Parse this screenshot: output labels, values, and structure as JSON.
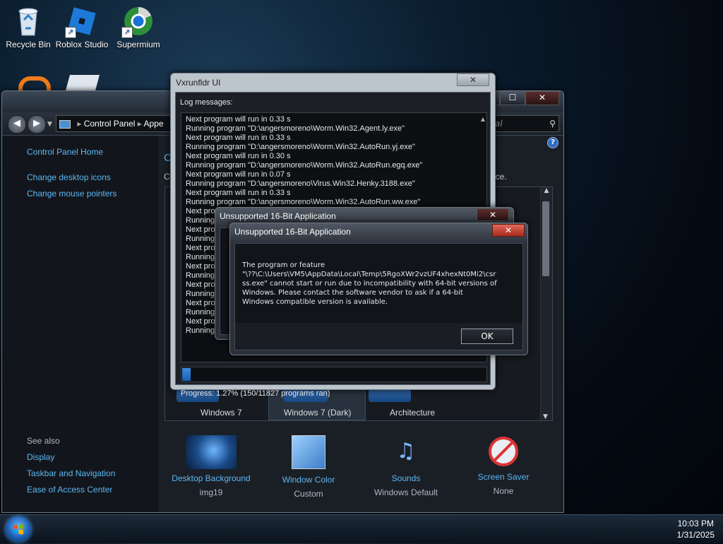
{
  "desktop": {
    "icons": [
      {
        "label": "Recycle Bin",
        "icon": "recycle-bin-icon"
      },
      {
        "label": "Roblox Studio",
        "icon": "roblox-studio-icon"
      },
      {
        "label": "Supermium",
        "icon": "supermium-icon"
      }
    ]
  },
  "control_panel": {
    "breadcrumb": [
      "Control Panel",
      "Appe"
    ],
    "search_placeholder": "al",
    "left_links": [
      "Control Panel Home",
      "Change desktop icons",
      "Change mouse pointers"
    ],
    "heading_partial": "C",
    "text_partial_left": "C",
    "text_partial_right": "nce.",
    "themes": [
      "Windows 7",
      "Windows 7 (Dark)",
      "Architecture"
    ],
    "see_also_label": "See also",
    "see_also_links": [
      "Display",
      "Taskbar and Navigation",
      "Ease of Access Center"
    ],
    "bottom_items": [
      {
        "label": "Desktop Background",
        "value": "img19"
      },
      {
        "label": "Window Color",
        "value": "Custom"
      },
      {
        "label": "Sounds",
        "value": "Windows Default"
      },
      {
        "label": "Screen Saver",
        "value": "None"
      }
    ]
  },
  "vx": {
    "title": "Vxrunfldr UI",
    "log_label": "Log messages:",
    "log": [
      "Next program will run in 0.33 s",
      "Running program \"D:\\angersmoreno\\Worm.Win32.Agent.ly.exe\"",
      "Next program will run in 0.33 s",
      "Running program \"D:\\angersmoreno\\Worm.Win32.AutoRun.yj.exe\"",
      "Next program will run in 0.30 s",
      "Running program \"D:\\angersmoreno\\Worm.Win32.AutoRun.egq.exe\"",
      "Next program will run in 0.07 s",
      "Running program \"D:\\angersmoreno\\Virus.Win32.Henky.3188.exe\"",
      "Next program will run in 0.33 s",
      "Running program \"D:\\angersmoreno\\Worm.Win32.AutoRun.ww.exe\"",
      "Next progr",
      "Running p",
      "Next prog",
      "Running p",
      "Next prog",
      "Running p",
      "Next prog",
      "Running p",
      "Next prog",
      "Running p",
      "Next prog",
      "Running p",
      "Next prog",
      "Running p"
    ],
    "progress_text": "Progress: 1.27% (150/11827 programs ran)",
    "progress_fraction": 0.0127
  },
  "dialog_back": {
    "title": "Unsupported 16-Bit Application"
  },
  "dialog_front": {
    "title": "Unsupported 16-Bit Application",
    "message_lines": [
      "The program or feature",
      "\"\\??\\C:\\Users\\VM5\\AppData\\Local\\Temp\\5RgoXWr2vzUF4xhexNt0Mi2\\csr",
      "ss.exe\" cannot start or run due to incompatibility with 64-bit versions of",
      "Windows. Please contact the software vendor to ask if a 64-bit",
      "Windows compatible version is available."
    ],
    "ok_label": "OK"
  },
  "taskbar": {
    "time": "10:03 PM",
    "date": "1/31/2025"
  }
}
